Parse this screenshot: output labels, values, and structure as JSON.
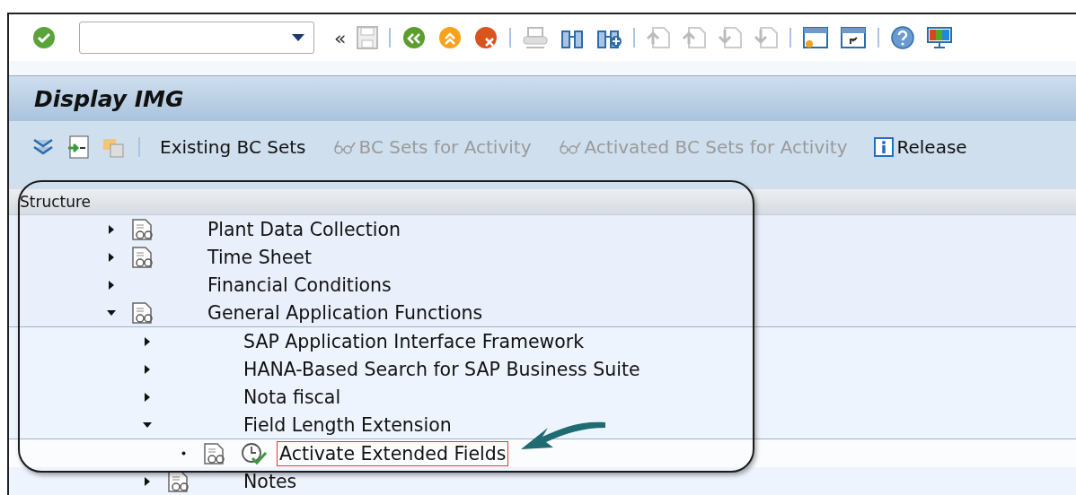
{
  "toolbar": {
    "collapse_glyph": "«"
  },
  "title": "Display IMG",
  "app_toolbar": [
    {
      "kind": "button",
      "label": "Existing BC Sets",
      "disabled": false
    },
    {
      "kind": "glasses",
      "label": "BC Sets for Activity",
      "disabled": true
    },
    {
      "kind": "glasses",
      "label": "Activated BC Sets for Activity",
      "disabled": true
    },
    {
      "kind": "info",
      "label": "Release",
      "disabled": false
    }
  ],
  "tree": {
    "header": "Structure",
    "items": [
      {
        "label": "Plant Data Collection",
        "kind": "node",
        "expanded": false,
        "doc": true,
        "selected": false
      },
      {
        "label": "Time Sheet",
        "kind": "node",
        "expanded": false,
        "doc": true,
        "selected": false
      },
      {
        "label": "Financial Conditions",
        "kind": "node",
        "expanded": false,
        "doc": false,
        "selected": false
      },
      {
        "label": "General Application Functions",
        "kind": "node",
        "expanded": true,
        "doc": true,
        "selected": false,
        "children": [
          {
            "label": "SAP Application Interface Framework",
            "kind": "node",
            "expanded": false,
            "doc": false,
            "selected": false
          },
          {
            "label": "HANA-Based Search for SAP Business Suite",
            "kind": "node",
            "expanded": false,
            "doc": false,
            "selected": false
          },
          {
            "label": "Nota fiscal",
            "kind": "node",
            "expanded": false,
            "doc": false,
            "selected": false
          },
          {
            "label": "Field Length Extension",
            "kind": "node",
            "expanded": true,
            "doc": false,
            "selected": false,
            "children": [
              {
                "label": "Activate Extended Fields",
                "kind": "activity",
                "doc": true,
                "selected": true
              }
            ]
          },
          {
            "label": "Notes",
            "kind": "node",
            "expanded": false,
            "doc": true,
            "selected": false
          }
        ]
      }
    ]
  }
}
